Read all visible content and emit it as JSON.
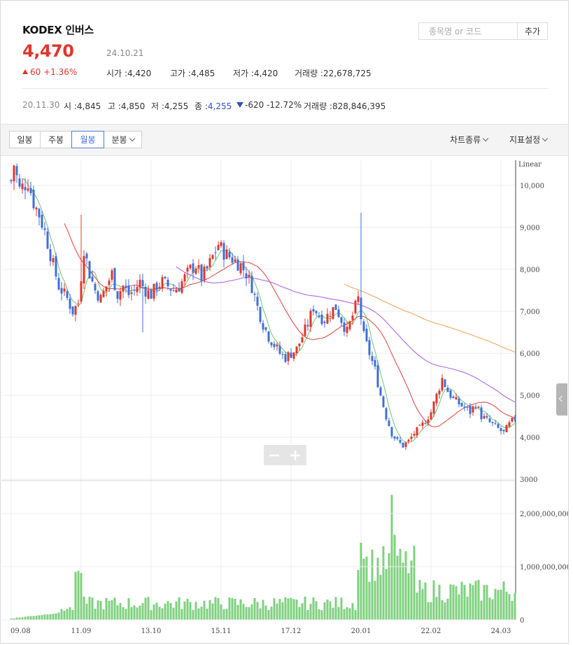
{
  "stock": {
    "name": "KODEX 인버스",
    "price": "4,470",
    "date": "24.10.21",
    "change": "60 +1.36%",
    "open_label": "시가 :",
    "open": "4,420",
    "high_label": "고가 :",
    "high": "4,485",
    "low_label": "저가 :",
    "low": "4,420",
    "volume_label": "거래량 :",
    "volume": "22,678,725"
  },
  "search": {
    "placeholder": "종목명 or 코드",
    "add_label": "추가"
  },
  "history": {
    "date": "20.11.30",
    "open_label": "시 :",
    "open": "4,845",
    "high_label": "고 :",
    "high": "4,850",
    "low_label": "저 :",
    "low": "4,255",
    "close_label": "종 :",
    "close": "4,255",
    "change": "-620 -12.72%",
    "volume_label": "거래량 :",
    "volume": "828,846,395"
  },
  "toolbar": {
    "tabs": [
      "일봉",
      "주봉",
      "월봉",
      "분봉"
    ],
    "active_tab": "월봉",
    "chart_type_label": "차트종류",
    "indicator_label": "지표설정"
  },
  "colors": {
    "up": "#e0362c",
    "down": "#3d6fd9",
    "ma5": "#7cc87c",
    "ma20": "#e0504a",
    "ma60": "#b367e6",
    "ma120": "#f0a860",
    "volume": "#7fd07f"
  },
  "chart_data": {
    "type": "candlestick",
    "scale_label": "Linear",
    "price_ylim": [
      3000,
      10600
    ],
    "price_ticks": [
      "10,000",
      "9,000",
      "8,000",
      "7,000",
      "6,000",
      "5,000",
      "4,000",
      "3000"
    ],
    "volume_ylim": [
      0,
      2500000000
    ],
    "volume_ticks": [
      "2,000,000,000",
      "1,000,000,000",
      "0"
    ],
    "x_ticks": [
      "09.08",
      "11.09",
      "13.10",
      "15.11",
      "17.12",
      "20.01",
      "22.02",
      "24.03"
    ],
    "x_tick_index": [
      0,
      25,
      50,
      75,
      100,
      125,
      150,
      175
    ],
    "n_periods": 181,
    "anchors_close": [
      [
        0,
        10100
      ],
      [
        1,
        10500
      ],
      [
        3,
        9900
      ],
      [
        6,
        10100
      ],
      [
        8,
        9600
      ],
      [
        10,
        9300
      ],
      [
        12,
        8900
      ],
      [
        15,
        8100
      ],
      [
        17,
        7600
      ],
      [
        20,
        7300
      ],
      [
        22,
        7000
      ],
      [
        24,
        7200
      ],
      [
        26,
        8500
      ],
      [
        28,
        7900
      ],
      [
        30,
        7500
      ],
      [
        32,
        7300
      ],
      [
        34,
        7600
      ],
      [
        36,
        7900
      ],
      [
        38,
        7400
      ],
      [
        40,
        7600
      ],
      [
        42,
        7400
      ],
      [
        44,
        7500
      ],
      [
        46,
        7700
      ],
      [
        48,
        7500
      ],
      [
        50,
        7400
      ],
      [
        52,
        7600
      ],
      [
        54,
        7700
      ],
      [
        56,
        7600
      ],
      [
        58,
        7500
      ],
      [
        60,
        7600
      ],
      [
        62,
        7800
      ],
      [
        64,
        8000
      ],
      [
        66,
        8100
      ],
      [
        68,
        7800
      ],
      [
        70,
        8000
      ],
      [
        72,
        8300
      ],
      [
        74,
        8600
      ],
      [
        76,
        8400
      ],
      [
        78,
        8300
      ],
      [
        80,
        8200
      ],
      [
        82,
        8100
      ],
      [
        84,
        7900
      ],
      [
        86,
        7600
      ],
      [
        88,
        7100
      ],
      [
        90,
        6700
      ],
      [
        92,
        6400
      ],
      [
        94,
        6200
      ],
      [
        96,
        6000
      ],
      [
        98,
        5900
      ],
      [
        100,
        6000
      ],
      [
        102,
        6100
      ],
      [
        104,
        6400
      ],
      [
        106,
        6700
      ],
      [
        108,
        7100
      ],
      [
        110,
        6900
      ],
      [
        112,
        6800
      ],
      [
        114,
        7000
      ],
      [
        116,
        7100
      ],
      [
        118,
        6800
      ],
      [
        120,
        6500
      ],
      [
        122,
        6900
      ],
      [
        124,
        7300
      ],
      [
        126,
        6400
      ],
      [
        128,
        6000
      ],
      [
        130,
        5600
      ],
      [
        132,
        5000
      ],
      [
        134,
        4500
      ],
      [
        136,
        4100
      ],
      [
        138,
        3900
      ],
      [
        140,
        3800
      ],
      [
        142,
        3900
      ],
      [
        144,
        4100
      ],
      [
        146,
        4200
      ],
      [
        148,
        4400
      ],
      [
        150,
        4600
      ],
      [
        152,
        5000
      ],
      [
        154,
        5400
      ],
      [
        156,
        5100
      ],
      [
        158,
        4900
      ],
      [
        160,
        4800
      ],
      [
        162,
        4700
      ],
      [
        164,
        4600
      ],
      [
        166,
        4800
      ],
      [
        168,
        4500
      ],
      [
        170,
        4400
      ],
      [
        172,
        4300
      ],
      [
        174,
        4200
      ],
      [
        176,
        4100
      ],
      [
        178,
        4300
      ],
      [
        180,
        4450
      ]
    ],
    "volume_spikes": [
      [
        23,
        900000000
      ],
      [
        24,
        920000000
      ],
      [
        25,
        880000000
      ],
      [
        125,
        1450000000
      ],
      [
        126,
        1150000000
      ],
      [
        136,
        2350000000
      ],
      [
        137,
        1600000000
      ],
      [
        135,
        1250000000
      ]
    ],
    "moving_averages": [
      "MA5",
      "MA20",
      "MA60",
      "MA120"
    ]
  }
}
